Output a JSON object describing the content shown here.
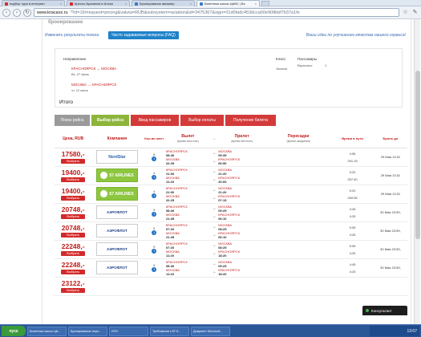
{
  "browser": {
    "tabs": [
      {
        "label": "подбор тура в интернет",
        "color": "#d12d2d",
        "active": false
      },
      {
        "label": "Кресло Бранкели в Алтаи",
        "color": "#d12d2d",
        "active": false
      },
      {
        "label": "Бронирование авиапер",
        "color": "#3a78c4",
        "active": false
      },
      {
        "label": "Билетные кассы ЦАВС | Бе",
        "color": "#3a78c4",
        "active": true
      }
    ],
    "url_host": "www.kracavs.ru",
    "url_rest": "/?id=16#request=pricing&valuta=RUB&subsystem=aviation&id=3475367&sign=01d0fadc453dcca00e908bbf7b37a1fe"
  },
  "page": {
    "cut_heading": "бронирование",
    "links": {
      "change_search": "Изменить результаты поиска",
      "faq": "Часто задаваемые вопросы (FAQ)",
      "idea": "Ваши идеи по улучшению качества нашего сервиса!"
    },
    "summary": {
      "direction_label": "Направление",
      "class_label": "Класс",
      "passengers_label": "Пассажиры",
      "route1": "КРАСНОЯРСК → МОСКВА",
      "route1_date": "Вс, 07 июнь",
      "route2": "МОСКВА → КРАСНОЯРСК",
      "route2_date": "чт, 12 июнь",
      "class_value": "Эконом",
      "adults_label": "Взрослых:",
      "adults_value": "1"
    },
    "total_label": "Итого",
    "steps": [
      "Поиск рейса",
      "Выбор рейса",
      "Ввод пассажиров",
      "Выбор оплаты",
      "Получение билета"
    ]
  },
  "table": {
    "headers": {
      "price": "Цена, RUB",
      "company": "Компания",
      "count": "Кол-во мест",
      "depart": "Вылет",
      "depart_sub": "(время местное)",
      "arrow": "→",
      "arrive": "Прилет",
      "arrive_sub": "(время местное)",
      "transfers": "Пересадки",
      "transfers_sub": "(время ожидания)",
      "time": "Время в пути",
      "book": "Бронь до"
    },
    "choose_label": "Выбрать",
    "rows": [
      {
        "price": "17580,-",
        "airline": "NordStar",
        "count": "8",
        "dep1": "КРАСНОЯРСК",
        "dt1": "08:40",
        "arr1": "МОСКВА",
        "at1": "09:35",
        "dep2": "МОСКВА",
        "dt2": "22:25",
        "arr2": "КРАСНОЯРСК",
        "at2": "06:50",
        "dur1": "4:55",
        "dur2": "291:15",
        "book": "29 Мая 13:31"
      },
      {
        "price": "19400,-",
        "airline": "S7 AIRLINES",
        "count": "4",
        "dep1": "КРАСНОЯРСК",
        "dt1": "21:00",
        "arr1": "МОСКВА",
        "at1": "21:20",
        "dep2": "МОСКВА",
        "dt2": "11:20",
        "arr2": "КРАСНОЯРСК",
        "at2": "20:00",
        "dur1": "5:20",
        "dur2": "257:40",
        "book": "29 Мая 13:31"
      },
      {
        "price": "19400,-",
        "airline": "S7 AIRLINES",
        "count": "4",
        "dep1": "КРАСНОЯРСК",
        "dt1": "21:00",
        "arr1": "МОСКВА",
        "at1": "21:20",
        "dep2": "МОСКВА",
        "dt2": "22:25",
        "arr2": "КРАСНОЯРСК",
        "at2": "07:15",
        "dur1": "5:20",
        "dur2": "269:55",
        "book": "29 Мая 13:31"
      },
      {
        "price": "20748,-",
        "airline": "АЭРОФЛОТ",
        "count": "9",
        "dep1": "КРАСНОЯРСК",
        "dt1": "08:40",
        "arr1": "МОСКВА",
        "at1": "09:25",
        "dep2": "МОСКВА",
        "dt2": "21:45",
        "arr2": "КРАСНОЯРСК",
        "at2": "06:10",
        "dur1": "4:45",
        "dur2": "4:25",
        "book": "30 Мая 23:59,"
      },
      {
        "price": "20748,-",
        "airline": "АЭРОФЛОТ",
        "count": "9",
        "dep1": "КРАСНОЯРСК",
        "dt1": "07:20",
        "arr1": "МОСКВА",
        "at1": "08:25",
        "dep2": "МОСКВА",
        "dt2": "21:45",
        "arr2": "КРАСНОЯРСК",
        "at2": "06:10",
        "dur1": "5:05",
        "dur2": "4:25",
        "book": "30 Мая 23:59,"
      },
      {
        "price": "22248,-",
        "airline": "АЭРОФЛОТ",
        "count": "9",
        "dep1": "КРАСНОЯРСК",
        "dt1": "07:20",
        "arr1": "МОСКВА",
        "at1": "08:25",
        "dep2": "МОСКВА",
        "dt2": "11:20",
        "arr2": "КРАСНОЯРСК",
        "at2": "18:20",
        "dur1": "5:05",
        "dur2": "4:25",
        "book": "30 Мая 23:59,"
      },
      {
        "price": "22248,-",
        "airline": "АЭРОФЛОТ",
        "count": "9",
        "dep1": "КРАСНОЯРСК",
        "dt1": "08:40",
        "arr1": "МОСКВА",
        "at1": "09:25",
        "dep2": "МОСКВА",
        "dt2": "11:20",
        "arr2": "КРАСНОЯРСК",
        "at2": "18:20",
        "dur1": "4:45",
        "dur2": "4:25",
        "book": "30 Мая 23:59,"
      },
      {
        "price": "23122,-",
        "airline": "",
        "count": "",
        "dep1": "",
        "dt1": "",
        "arr1": "",
        "at1": "",
        "dep2": "",
        "dt2": "",
        "arr2": "",
        "at2": "",
        "dur1": "",
        "dur2": "",
        "book": ""
      }
    ]
  },
  "consultant": "Консультант",
  "taskbar": {
    "start": "пуск",
    "items": [
      "Билетные кассы ЦА...",
      "Бронирование пере...",
      "ИТИ",
      "Требования к ЕГЭ...",
      "Документ Microsoft..."
    ],
    "clock": "13:07"
  }
}
